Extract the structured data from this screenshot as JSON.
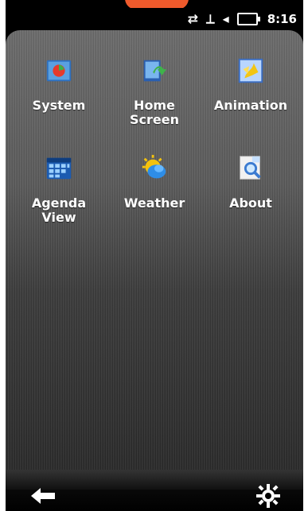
{
  "status": {
    "time": "8:16"
  },
  "apps": [
    {
      "label": "System",
      "icon": "system-icon"
    },
    {
      "label": "Home Screen",
      "icon": "home-screen-icon"
    },
    {
      "label": "Animation",
      "icon": "animation-icon"
    },
    {
      "label": "Agenda View",
      "icon": "calendar-icon"
    },
    {
      "label": "Weather",
      "icon": "weather-icon"
    },
    {
      "label": "About",
      "icon": "about-icon"
    }
  ],
  "bottom": {
    "back": "back-arrow-icon",
    "settings": "settings-gear-icon"
  },
  "colors": {
    "accent": "#ef5a2c",
    "text": "#ffffff",
    "background": "#000000"
  }
}
